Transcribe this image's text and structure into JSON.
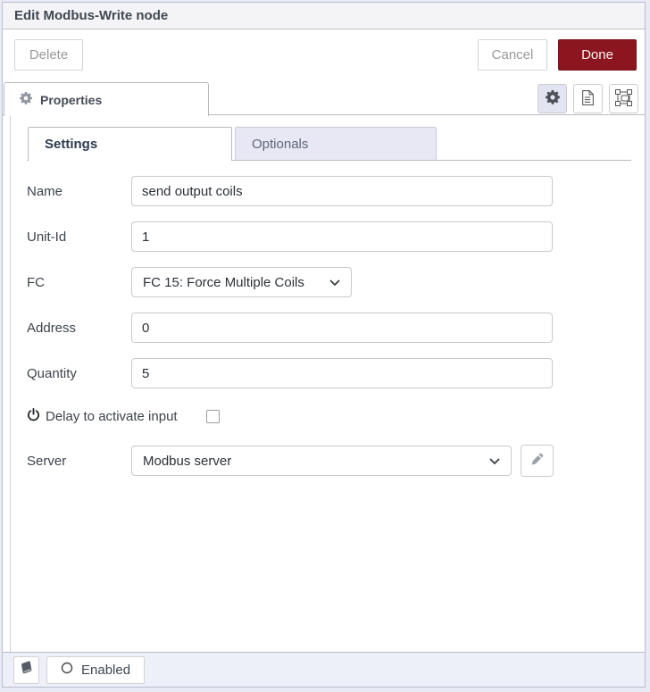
{
  "dialog": {
    "title": "Edit Modbus-Write node",
    "toolbar": {
      "delete_label": "Delete",
      "cancel_label": "Cancel",
      "done_label": "Done"
    },
    "properties_tab_label": "Properties",
    "icon_buttons": [
      "gear-icon",
      "document-icon",
      "node-appearance-icon"
    ]
  },
  "form": {
    "tabs": [
      {
        "label": "Settings",
        "active": true
      },
      {
        "label": "Optionals",
        "active": false
      }
    ],
    "fields": {
      "name": {
        "label": "Name",
        "value": "send output coils"
      },
      "unit_id": {
        "label": "Unit-Id",
        "value": "1"
      },
      "fc": {
        "label": "FC",
        "value": "FC 15: Force Multiple Coils"
      },
      "address": {
        "label": "Address",
        "value": "0"
      },
      "quantity": {
        "label": "Quantity",
        "value": "5"
      },
      "delay": {
        "label": "Delay to activate input",
        "checked": false
      },
      "server": {
        "label": "Server",
        "value": "Modbus server"
      }
    }
  },
  "footer": {
    "enabled_label": "Enabled"
  },
  "colors": {
    "done_button": "#8B161F",
    "inactive_tab_bg": "#E7E8F4",
    "footer_bg": "#EEF0F9",
    "page_bg": "#E8EAF6"
  }
}
